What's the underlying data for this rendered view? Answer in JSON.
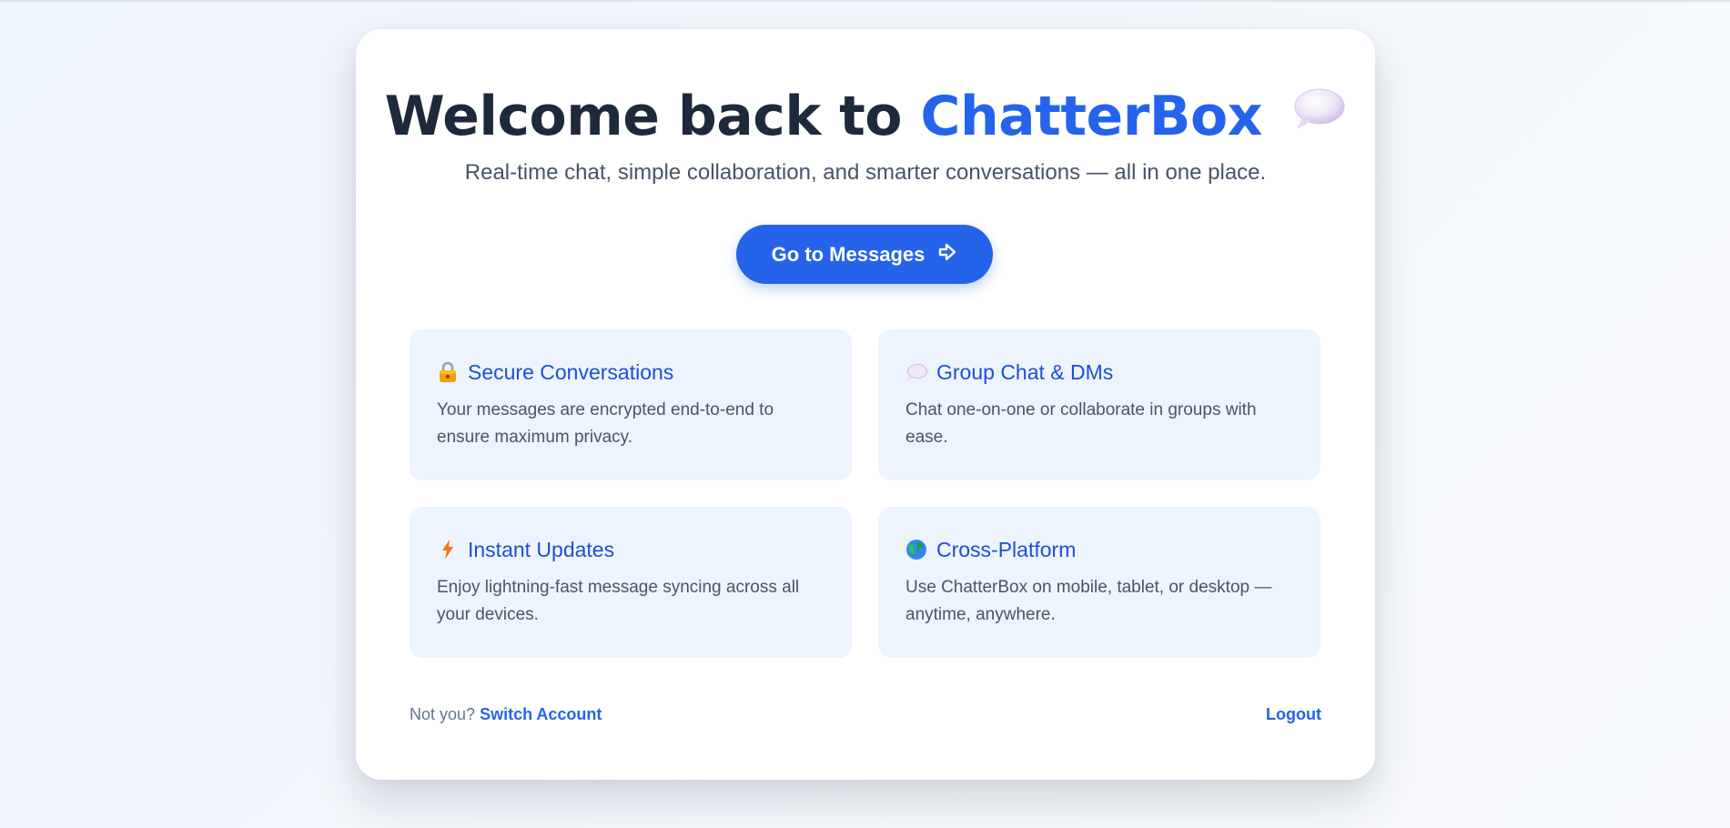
{
  "welcome": {
    "headline_prefix": "Welcome back to",
    "brand_name": "ChatterBox",
    "headline_icon": "speech-bubble-icon",
    "subtitle": "Real-time chat, simple collaboration, and smarter conversations — all in one place."
  },
  "cta": {
    "label": "Go to Messages",
    "icon": "arrow-right-icon"
  },
  "features": [
    {
      "icon": "lock-icon",
      "title": "Secure Conversations",
      "description": "Your messages are encrypted end-to-end to ensure maximum privacy."
    },
    {
      "icon": "speech-bubble-icon",
      "title": "Group Chat & DMs",
      "description": "Chat one-on-one or collaborate in groups with ease."
    },
    {
      "icon": "lightning-icon",
      "title": "Instant Updates",
      "description": "Enjoy lightning-fast message syncing across all your devices."
    },
    {
      "icon": "globe-icon",
      "title": "Cross-Platform",
      "description": "Use ChatterBox on mobile, tablet, or desktop — anytime, anywhere."
    }
  ],
  "footer": {
    "prompt": "Not you?",
    "switch_label": "Switch Account",
    "logout_label": "Logout"
  },
  "colors": {
    "brand": "#2563eb",
    "heading": "#1e293b",
    "feature_bg": "#eef4fe",
    "feature_title": "#1d4ed8"
  }
}
